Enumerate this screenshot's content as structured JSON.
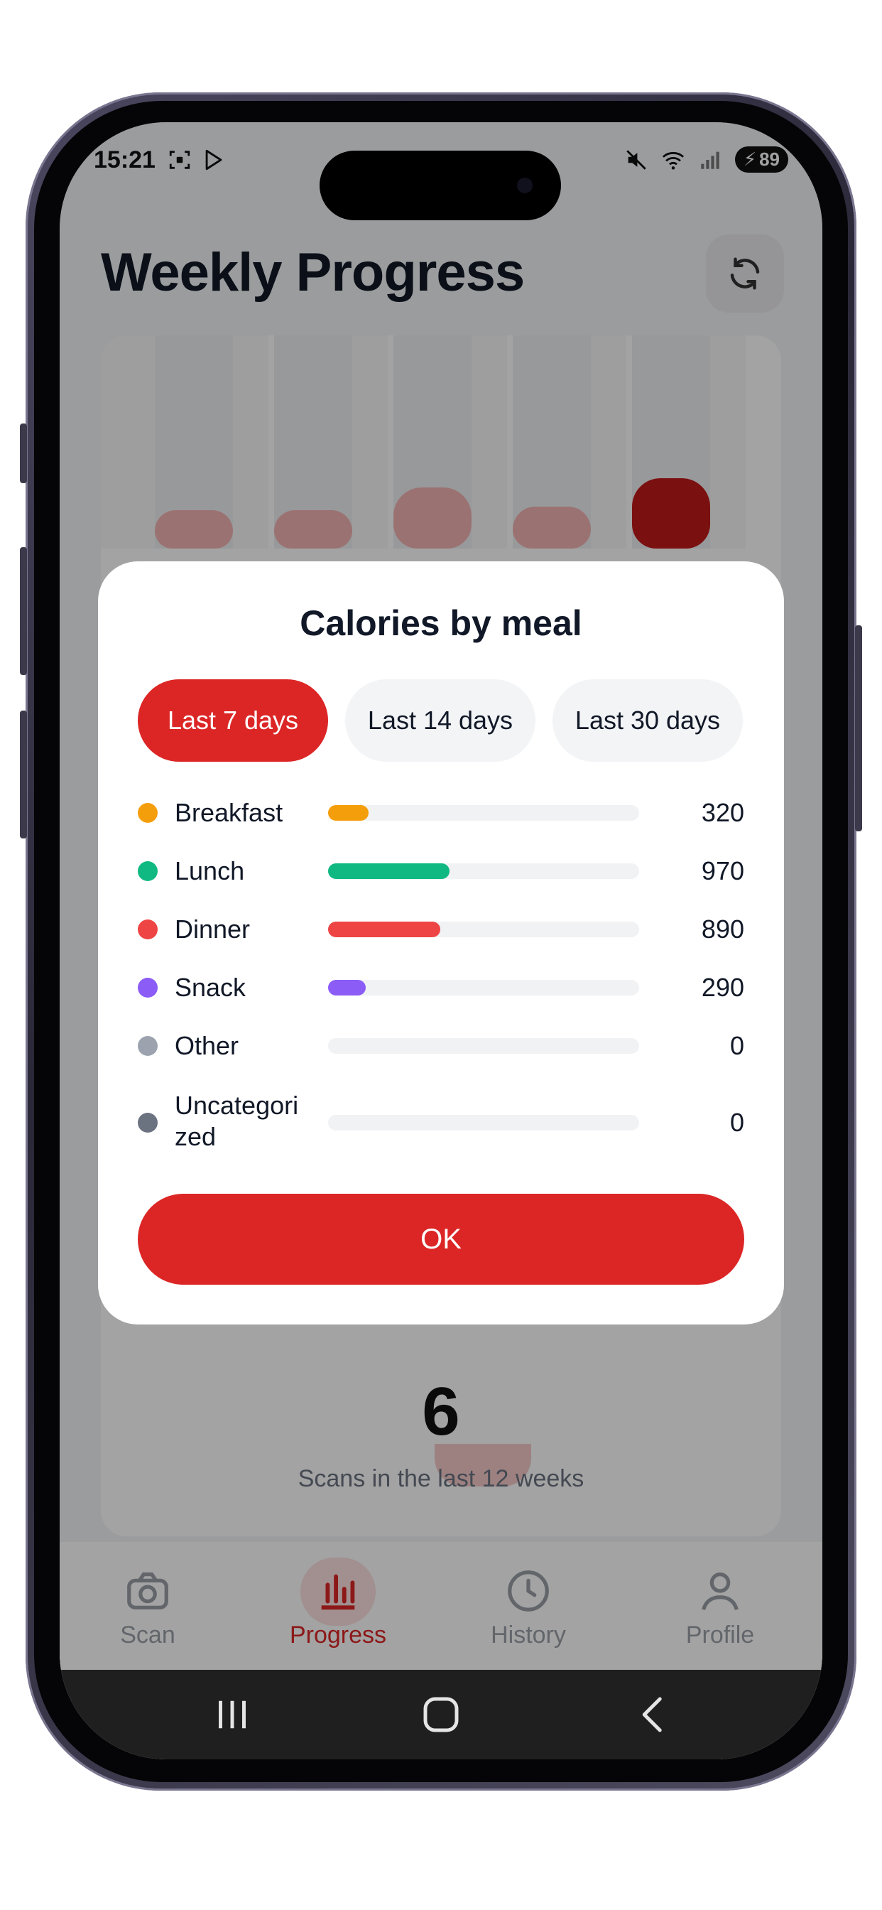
{
  "status_bar": {
    "time": "15:21",
    "battery": "89"
  },
  "page": {
    "title": "Weekly Progress"
  },
  "chart": {
    "scan_count": "6",
    "scan_label": "Scans in the last 12 weeks",
    "bar_levels": [
      0.12,
      0.12,
      0.19,
      0.13,
      0.22
    ],
    "bar_colors": [
      "#f2b3b3",
      "#f2b3b3",
      "#f2b3b3",
      "#f2b3b3",
      "#c11a1a"
    ]
  },
  "dialog": {
    "title": "Calories by meal",
    "ranges": [
      {
        "label": "Last 7 days",
        "active": true
      },
      {
        "label": "Last 14 days",
        "active": false
      },
      {
        "label": "Last 30 days",
        "active": false
      }
    ],
    "meals": [
      {
        "label": "Breakfast",
        "value": "320",
        "fraction": 0.13,
        "color": "#f59e0b"
      },
      {
        "label": "Lunch",
        "value": "970",
        "fraction": 0.39,
        "color": "#10b981"
      },
      {
        "label": "Dinner",
        "value": "890",
        "fraction": 0.36,
        "color": "#ef4444"
      },
      {
        "label": "Snack",
        "value": "290",
        "fraction": 0.12,
        "color": "#8b5cf6"
      },
      {
        "label": "Other",
        "value": "0",
        "fraction": 0,
        "color": "#9ca3af"
      },
      {
        "label": "Uncategori zed",
        "value": "0",
        "fraction": 0,
        "color": "#6b7280"
      }
    ],
    "ok_label": "OK"
  },
  "tabs": [
    {
      "label": "Scan",
      "icon": "camera-icon",
      "active": false
    },
    {
      "label": "Progress",
      "icon": "bar-chart-icon",
      "active": true
    },
    {
      "label": "History",
      "icon": "clock-icon",
      "active": false
    },
    {
      "label": "Profile",
      "icon": "user-icon",
      "active": false
    }
  ],
  "colors": {
    "accent": "#dc2626"
  }
}
